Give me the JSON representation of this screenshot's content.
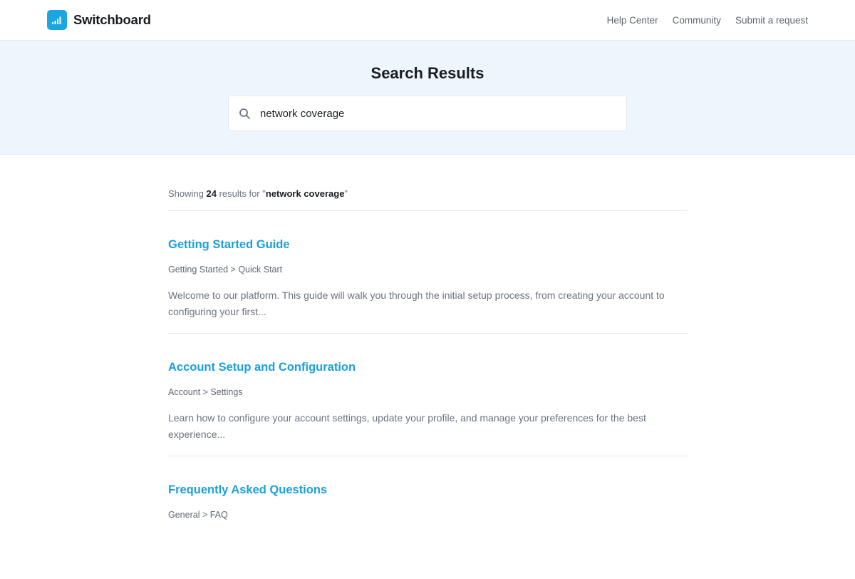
{
  "header": {
    "brand_name": "Switchboard",
    "brand_icon": "signal-bars-icon",
    "nav": [
      {
        "label": "Help Center"
      },
      {
        "label": "Community"
      },
      {
        "label": "Submit a request"
      }
    ]
  },
  "hero": {
    "title": "Search Results",
    "search_icon": "search-icon",
    "search_value": "network coverage"
  },
  "summary": {
    "prefix": "Showing ",
    "count": "24",
    "middle": " results for \"",
    "query": "network coverage",
    "suffix": "\""
  },
  "results": [
    {
      "title": "Getting Started Guide",
      "breadcrumb": "Getting Started > Quick Start",
      "excerpt": "Welcome to our platform. This guide will walk you through the initial setup process, from creating your account to configuring your first..."
    },
    {
      "title": "Account Setup and Configuration",
      "breadcrumb": "Account > Settings",
      "excerpt": "Learn how to configure your account settings, update your profile, and manage your preferences for the best experience..."
    },
    {
      "title": "Frequently Asked Questions",
      "breadcrumb": "General > FAQ",
      "excerpt": ""
    }
  ],
  "colors": {
    "accent": "#1a9fe0",
    "brand": "#1ba6e3",
    "hero_background": "#eef6fd"
  }
}
